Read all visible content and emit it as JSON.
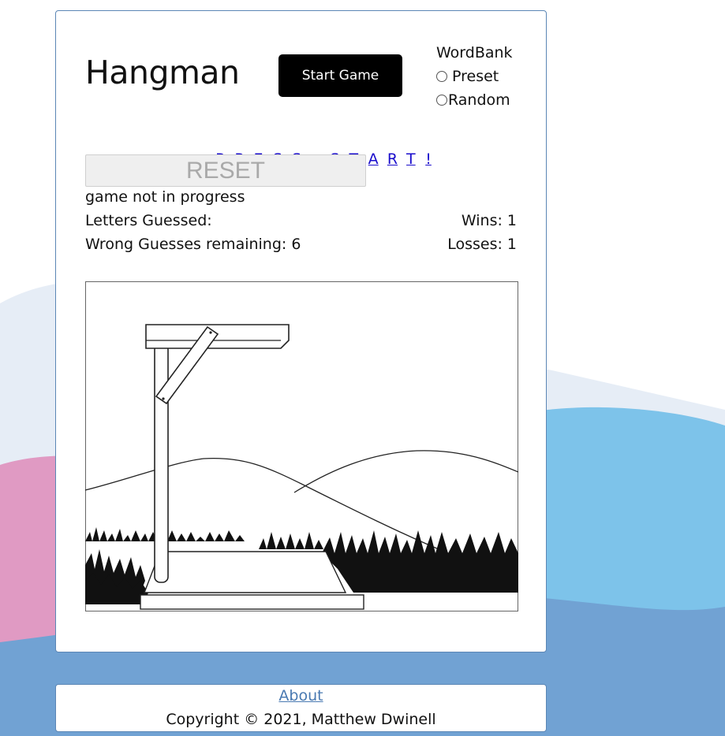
{
  "title": "Hangman",
  "start_button": "Start Game",
  "wordbank": {
    "label": "WordBank",
    "options": [
      {
        "label": "Preset",
        "checked": false
      },
      {
        "label": "Random",
        "checked": false
      }
    ]
  },
  "puzzle_letters": [
    "P",
    "R",
    "E",
    "S",
    "S",
    "_",
    "S",
    "T",
    "A",
    "R",
    "T",
    "!"
  ],
  "reset_button": "RESET",
  "status_text": "game not in progress",
  "letters_guessed_label": "Letters Guessed:",
  "wins_label": "Wins: 1",
  "wrong_guesses_label": "Wrong Guesses remaining: 6",
  "losses_label": "Losses: 1",
  "footer": {
    "about": "About",
    "copyright": "Copyright © 2021, Matthew Dwinell"
  },
  "colors": {
    "link": "#1a0dcc",
    "footer_link": "#4a7ab2",
    "bg_pink": "#e09ac3",
    "bg_lightblue": "#7dc3ea",
    "bg_blue": "#71a2d3",
    "bg_pale": "#e6edf6"
  }
}
